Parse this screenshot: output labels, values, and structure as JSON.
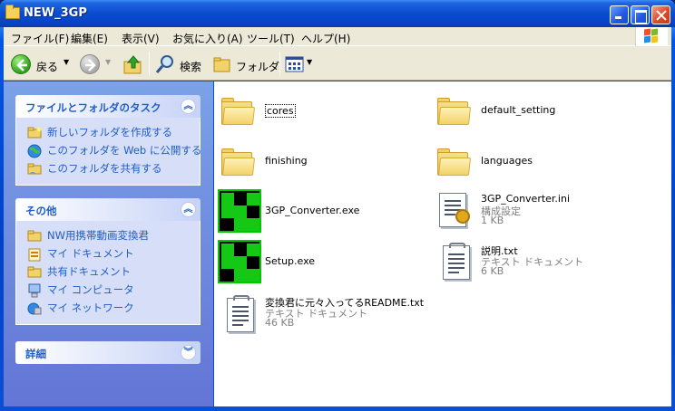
{
  "window": {
    "title": "NEW_3GP"
  },
  "menu": {
    "items": [
      "ファイル(F)",
      "編集(E)",
      "表示(V)",
      "お気に入り(A)",
      "ツール(T)",
      "ヘルプ(H)"
    ]
  },
  "toolbar": {
    "back_label": "戻る",
    "search_label": "検索",
    "folders_label": "フォルダ"
  },
  "tasks_panel": {
    "title": "ファイルとフォルダのタスク",
    "items": [
      "新しいフォルダを作成する",
      "このフォルダを Web に公開する",
      "このフォルダを共有する"
    ]
  },
  "other_panel": {
    "title": "その他",
    "items": [
      "NW用携帯動画変換君",
      "マイ ドキュメント",
      "共有ドキュメント",
      "マイ コンピュータ",
      "マイ ネットワーク"
    ]
  },
  "details_panel": {
    "title": "詳細"
  },
  "files": [
    {
      "name": "cores",
      "type": "folder"
    },
    {
      "name": "default_setting",
      "type": "folder"
    },
    {
      "name": "finishing",
      "type": "folder"
    },
    {
      "name": "languages",
      "type": "folder"
    },
    {
      "name": "3GP_Converter.exe",
      "type": "exe"
    },
    {
      "name": "3GP_Converter.ini",
      "type": "ini",
      "kind": "構成設定",
      "size": "1 KB"
    },
    {
      "name": "Setup.exe",
      "type": "exe"
    },
    {
      "name": "説明.txt",
      "type": "txt",
      "kind": "テキスト ドキュメント",
      "size": "6 KB"
    },
    {
      "name": "変換君に元々入ってるREADME.txt",
      "type": "txt",
      "kind": "テキスト ドキュメント",
      "size": "46 KB"
    }
  ],
  "colors": {
    "titlebar": "#0a4bd0",
    "task_link": "#215dc6",
    "pane_bg": "#7ba2e7",
    "exe_green": "#16c816"
  }
}
